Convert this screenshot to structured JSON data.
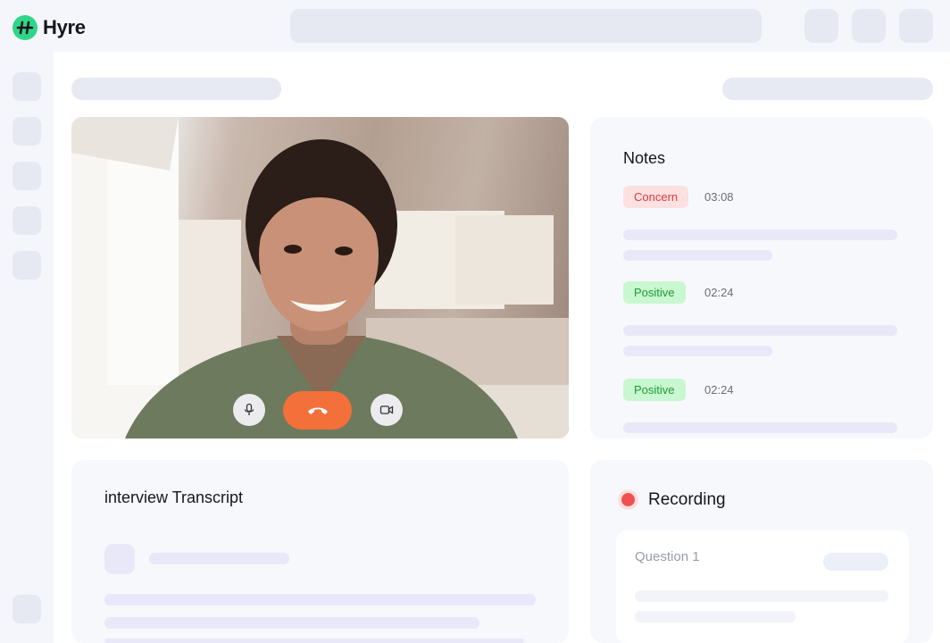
{
  "app": {
    "name": "Hyre"
  },
  "notes": {
    "title": "Notes",
    "items": [
      {
        "tag": "Concern",
        "time": "03:08",
        "tag_color": "#e03a3a"
      },
      {
        "tag": "Positive",
        "time": "02:24",
        "tag_color": "#1d9b3a"
      },
      {
        "tag": "Positive",
        "time": "02:24",
        "tag_color": "#1d9b3a"
      }
    ]
  },
  "transcript": {
    "title": "interview Transcript"
  },
  "recording": {
    "label": "Recording",
    "question_label": "Question 1"
  },
  "call_controls": {
    "mic_icon": "microphone-icon",
    "end_icon": "phone-hangup-icon",
    "video_icon": "video-camera-icon",
    "end_color": "#f4703a"
  },
  "colors": {
    "brand": "#2fd68a",
    "recording": "#f05050"
  }
}
